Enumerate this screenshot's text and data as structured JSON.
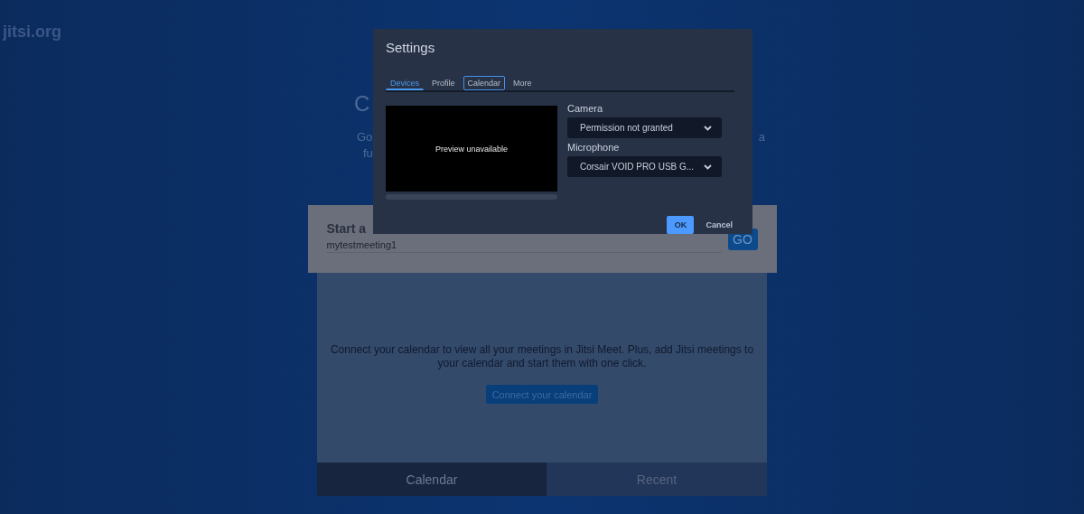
{
  "page": {
    "logo": "jitsi.org",
    "heading_fragment": "C",
    "description_fragments": {
      "line_1_left": "Go",
      "line_1_right": "a",
      "line_2_left": "fu"
    }
  },
  "start_meeting": {
    "title": "Start a",
    "value": "mytestmeeting1",
    "go_button": "GO"
  },
  "calendar_panel": {
    "message": "Connect your calendar to view all your meetings in Jitsi Meet. Plus, add Jitsi meetings to your calendar and start them with one click.",
    "connect_button": "Connect your calendar"
  },
  "bottom_tabs": [
    {
      "label": "Calendar",
      "selected": true
    },
    {
      "label": "Recent",
      "selected": false
    }
  ],
  "settings_dialog": {
    "title": "Settings",
    "tabs": [
      {
        "label": "Devices",
        "selected": true,
        "focused": false
      },
      {
        "label": "Profile",
        "selected": false,
        "focused": false
      },
      {
        "label": "Calendar",
        "selected": false,
        "focused": true
      },
      {
        "label": "More",
        "selected": false,
        "focused": false
      }
    ],
    "preview_text": "Preview unavailable",
    "fields": [
      {
        "label": "Camera",
        "value": "Permission not granted"
      },
      {
        "label": "Microphone",
        "value": "Corsair VOID PRO USB G..."
      }
    ],
    "ok_button": "OK",
    "cancel_button": "Cancel"
  }
}
